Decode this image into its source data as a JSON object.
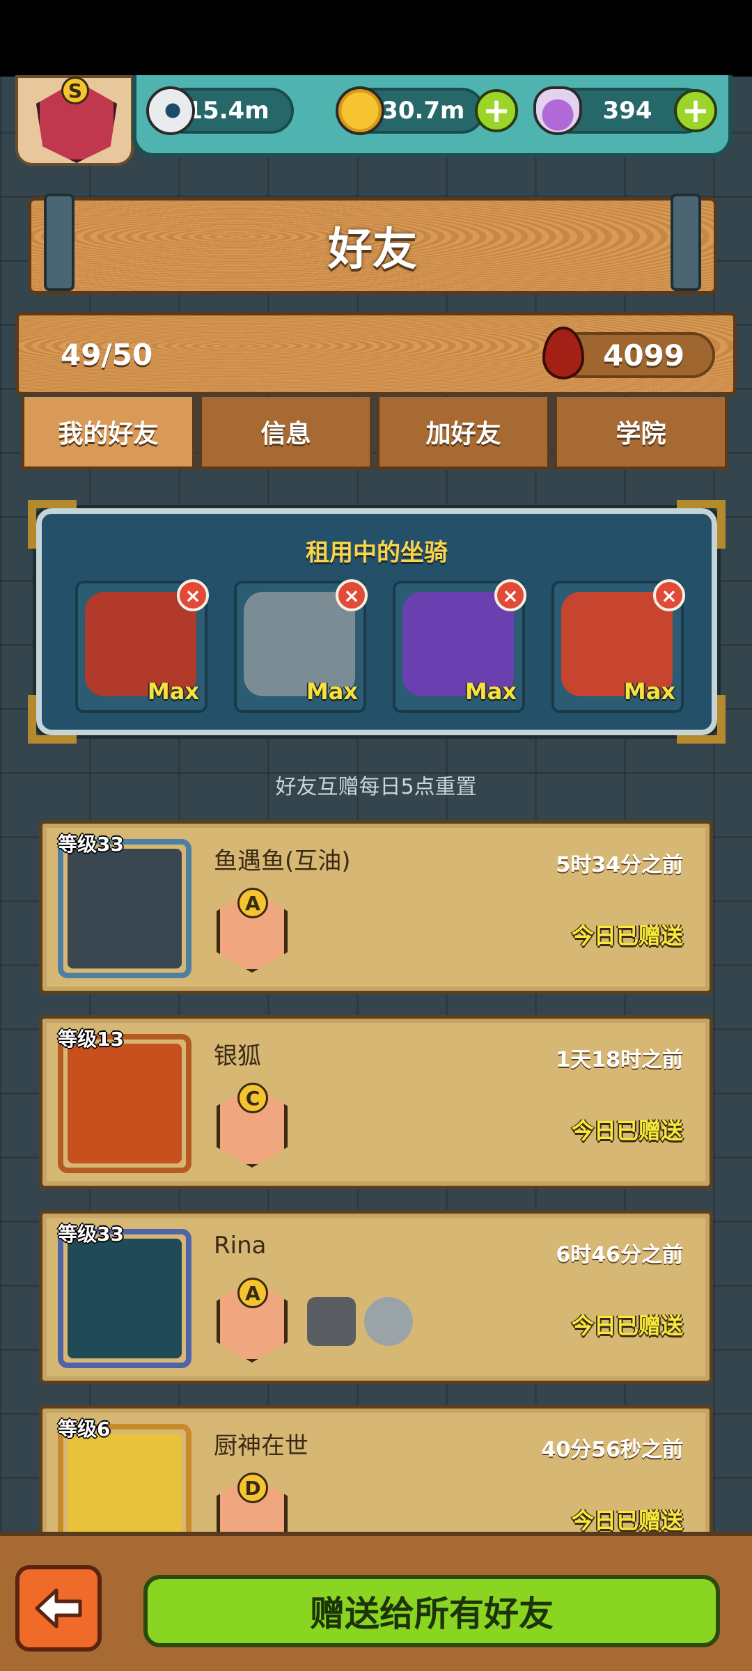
{
  "resources": {
    "eyeball": {
      "value": "15.4m",
      "icon": "eyeball-icon"
    },
    "coins": {
      "value": "130.7m",
      "icon": "coin-icon"
    },
    "potion": {
      "value": "394",
      "icon": "potion-icon"
    }
  },
  "rank_badge": {
    "letter": "S"
  },
  "title": "好友",
  "friend_count": "49/50",
  "blood": {
    "value": "4099",
    "icon": "blood-drop-icon"
  },
  "tabs": [
    {
      "label": "我的好友",
      "active": true
    },
    {
      "label": "信息",
      "active": false
    },
    {
      "label": "加好友",
      "active": false
    },
    {
      "label": "学院",
      "active": false
    }
  ],
  "mounts": {
    "title": "租用中的坐骑",
    "items": [
      {
        "name": "red-horned-demon-mount",
        "level": "Max",
        "color": "#b23a2b"
      },
      {
        "name": "pipe-machine-mount",
        "level": "Max",
        "color": "#7b8c94"
      },
      {
        "name": "purple-rose-mount",
        "level": "Max",
        "color": "#6a3fb0"
      },
      {
        "name": "tribal-mask-mount",
        "level": "Max",
        "color": "#c7452f"
      }
    ]
  },
  "reset_note": "好友互赠每日5点重置",
  "friends": [
    {
      "level": "等级33",
      "name": "鱼遇鱼(互油)",
      "time": "5时34分之前",
      "status": "今日已赠送",
      "badge": "A",
      "badge_color": "#d9a23a",
      "avatar_color": "#3a4650",
      "frame_color": "#4f7fa0",
      "extras": []
    },
    {
      "level": "等级13",
      "name": "银狐",
      "time": "1天18时之前",
      "status": "今日已赠送",
      "badge": "C",
      "badge_color": "#4d8fb8",
      "avatar_color": "#c8501e",
      "frame_color": "#b55a22",
      "extras": []
    },
    {
      "level": "等级33",
      "name": "Rina",
      "time": "6时46分之前",
      "status": "今日已赠送",
      "badge": "A",
      "badge_color": "#d9a23a",
      "avatar_color": "#1f4a56",
      "frame_color": "#4f63a8",
      "extras": [
        "gray-monster-icon",
        "robot-fish-icon"
      ]
    },
    {
      "level": "等级6",
      "name": "厨神在世",
      "time": "40分56秒之前",
      "status": "今日已赠送",
      "badge": "D",
      "badge_color": "#5aa04a",
      "avatar_color": "#e8c23a",
      "frame_color": "#c98a2a",
      "extras": []
    }
  ],
  "bottom": {
    "send_all_label": "赠送给所有好友",
    "back_icon": "back-arrow-icon"
  }
}
